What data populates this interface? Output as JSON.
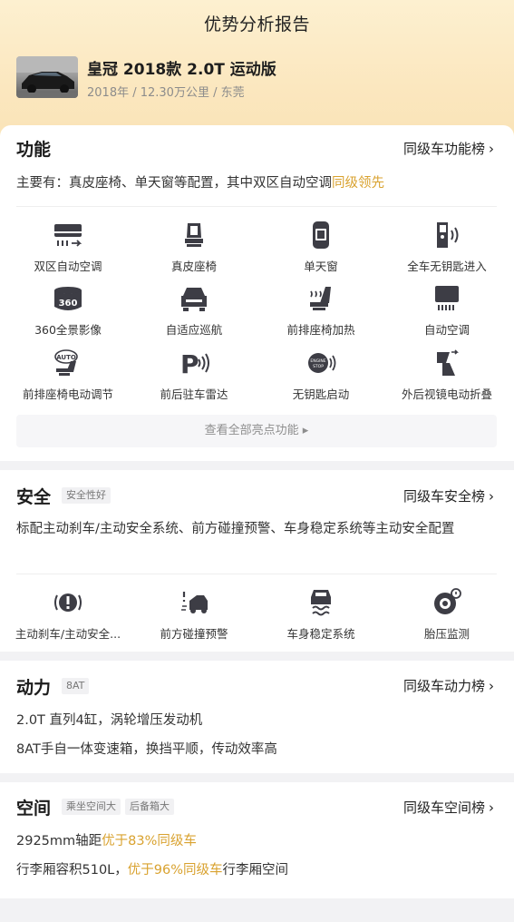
{
  "header": {
    "title": "优势分析报告",
    "car_name": "皇冠 2018款 2.0T 运动版",
    "car_meta": "2018年 / 12.30万公里 / 东莞"
  },
  "function": {
    "title": "功能",
    "rank_label": "同级车功能榜",
    "summary_prefix": "主要有：真皮座椅、单天窗等配置，其中双区自动空调",
    "summary_highlight": "同级领先",
    "features": [
      {
        "label": "双区自动空调",
        "icon": "dual-zone-ac-icon"
      },
      {
        "label": "真皮座椅",
        "icon": "leather-seat-icon"
      },
      {
        "label": "单天窗",
        "icon": "sunroof-icon"
      },
      {
        "label": "全车无钥匙进入",
        "icon": "keyless-entry-icon"
      },
      {
        "label": "360全景影像",
        "icon": "360-camera-icon"
      },
      {
        "label": "自适应巡航",
        "icon": "adaptive-cruise-icon"
      },
      {
        "label": "前排座椅加热",
        "icon": "seat-heating-icon"
      },
      {
        "label": "自动空调",
        "icon": "auto-ac-icon"
      },
      {
        "label": "前排座椅电动调节",
        "icon": "power-seat-icon"
      },
      {
        "label": "前后驻车雷达",
        "icon": "parking-radar-icon"
      },
      {
        "label": "无钥匙启动",
        "icon": "keyless-start-icon"
      },
      {
        "label": "外后视镜电动折叠",
        "icon": "mirror-fold-icon"
      }
    ],
    "view_all": "查看全部亮点功能 ▸"
  },
  "safety": {
    "title": "安全",
    "tag": "安全性好",
    "rank_label": "同级车安全榜",
    "summary": "标配主动刹车/主动安全系统、前方碰撞预警、车身稳定系统等主动安全配置",
    "features": [
      {
        "label": "主动刹车/主动安全...",
        "icon": "active-brake-icon"
      },
      {
        "label": "前方碰撞预警",
        "icon": "collision-warning-icon"
      },
      {
        "label": "车身稳定系统",
        "icon": "stability-control-icon"
      },
      {
        "label": "胎压监测",
        "icon": "tire-pressure-icon"
      }
    ]
  },
  "power": {
    "title": "动力",
    "tag": "8AT",
    "rank_label": "同级车动力榜",
    "line1": "2.0T 直列4缸，涡轮增压发动机",
    "line2": "8AT手自一体变速箱，换挡平顺，传动效率高"
  },
  "space": {
    "title": "空间",
    "tags": [
      "乘坐空间大",
      "后备箱大"
    ],
    "rank_label": "同级车空间榜",
    "line1_prefix": "2925mm轴距",
    "line1_highlight": "优于83%同级车",
    "line2_prefix": "行李厢容积510L，",
    "line2_highlight": "优于96%同级车",
    "line2_suffix": "行李厢空间"
  },
  "colors": {
    "highlight": "#d9a22f",
    "icon": "#3d3d45",
    "hero": "#fbe7bf"
  }
}
